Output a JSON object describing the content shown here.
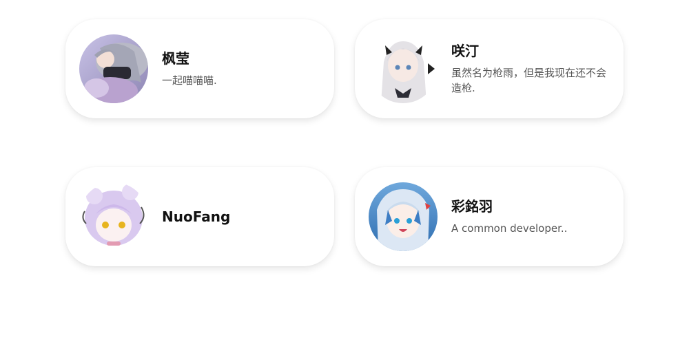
{
  "friends": [
    {
      "name": "枫莹",
      "description": "一起喵喵喵."
    },
    {
      "name": "咲汀",
      "description": "虽然名为枪雨，但是我现在还不会造枪."
    },
    {
      "name": "NuoFang",
      "description": ""
    },
    {
      "name": "彩銘羽",
      "description": "A common developer.."
    }
  ]
}
